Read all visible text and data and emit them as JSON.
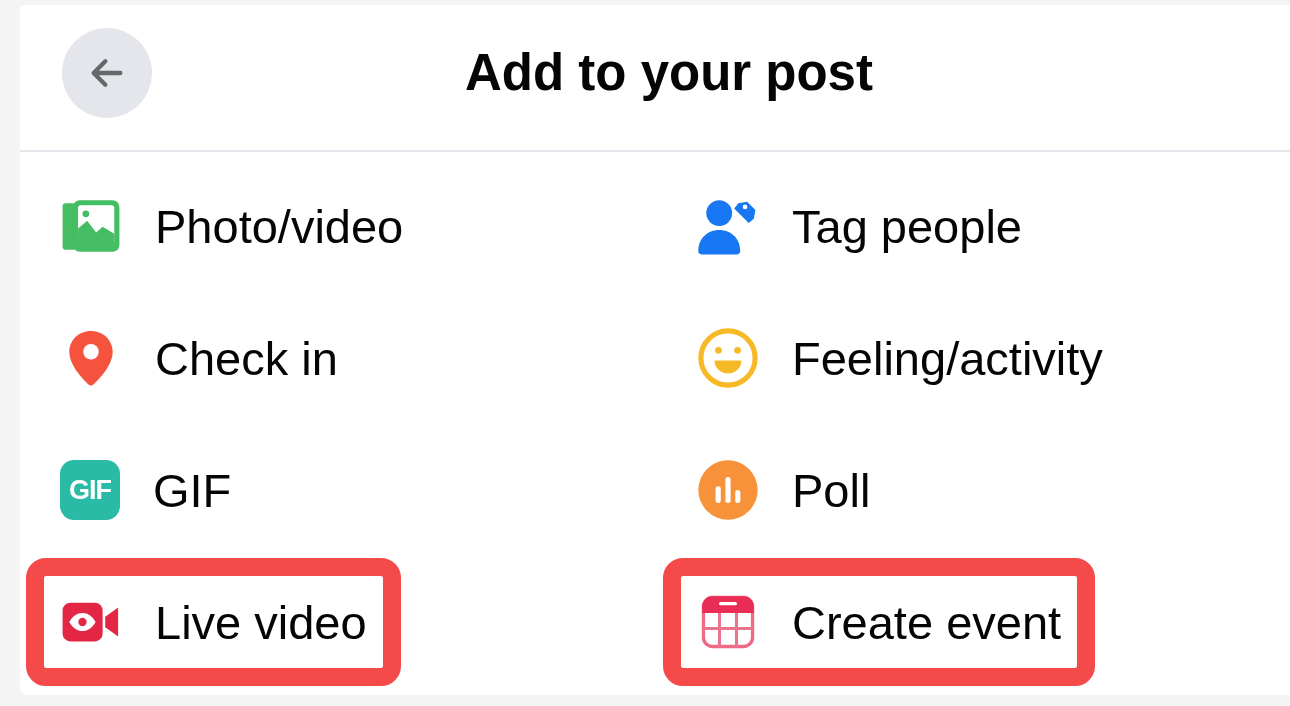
{
  "header": {
    "title": "Add to your post"
  },
  "options": [
    {
      "kind": "photo",
      "label": "Photo/video",
      "highlighted": false
    },
    {
      "kind": "tag",
      "label": "Tag people",
      "highlighted": false
    },
    {
      "kind": "checkin",
      "label": "Check in",
      "highlighted": false
    },
    {
      "kind": "feeling",
      "label": "Feeling/activity",
      "highlighted": false
    },
    {
      "kind": "gif",
      "label": "GIF",
      "icon_text": "GIF",
      "highlighted": false
    },
    {
      "kind": "poll",
      "label": "Poll",
      "highlighted": false
    },
    {
      "kind": "live",
      "label": "Live video",
      "highlighted": true
    },
    {
      "kind": "event",
      "label": "Create event",
      "highlighted": true
    }
  ]
}
